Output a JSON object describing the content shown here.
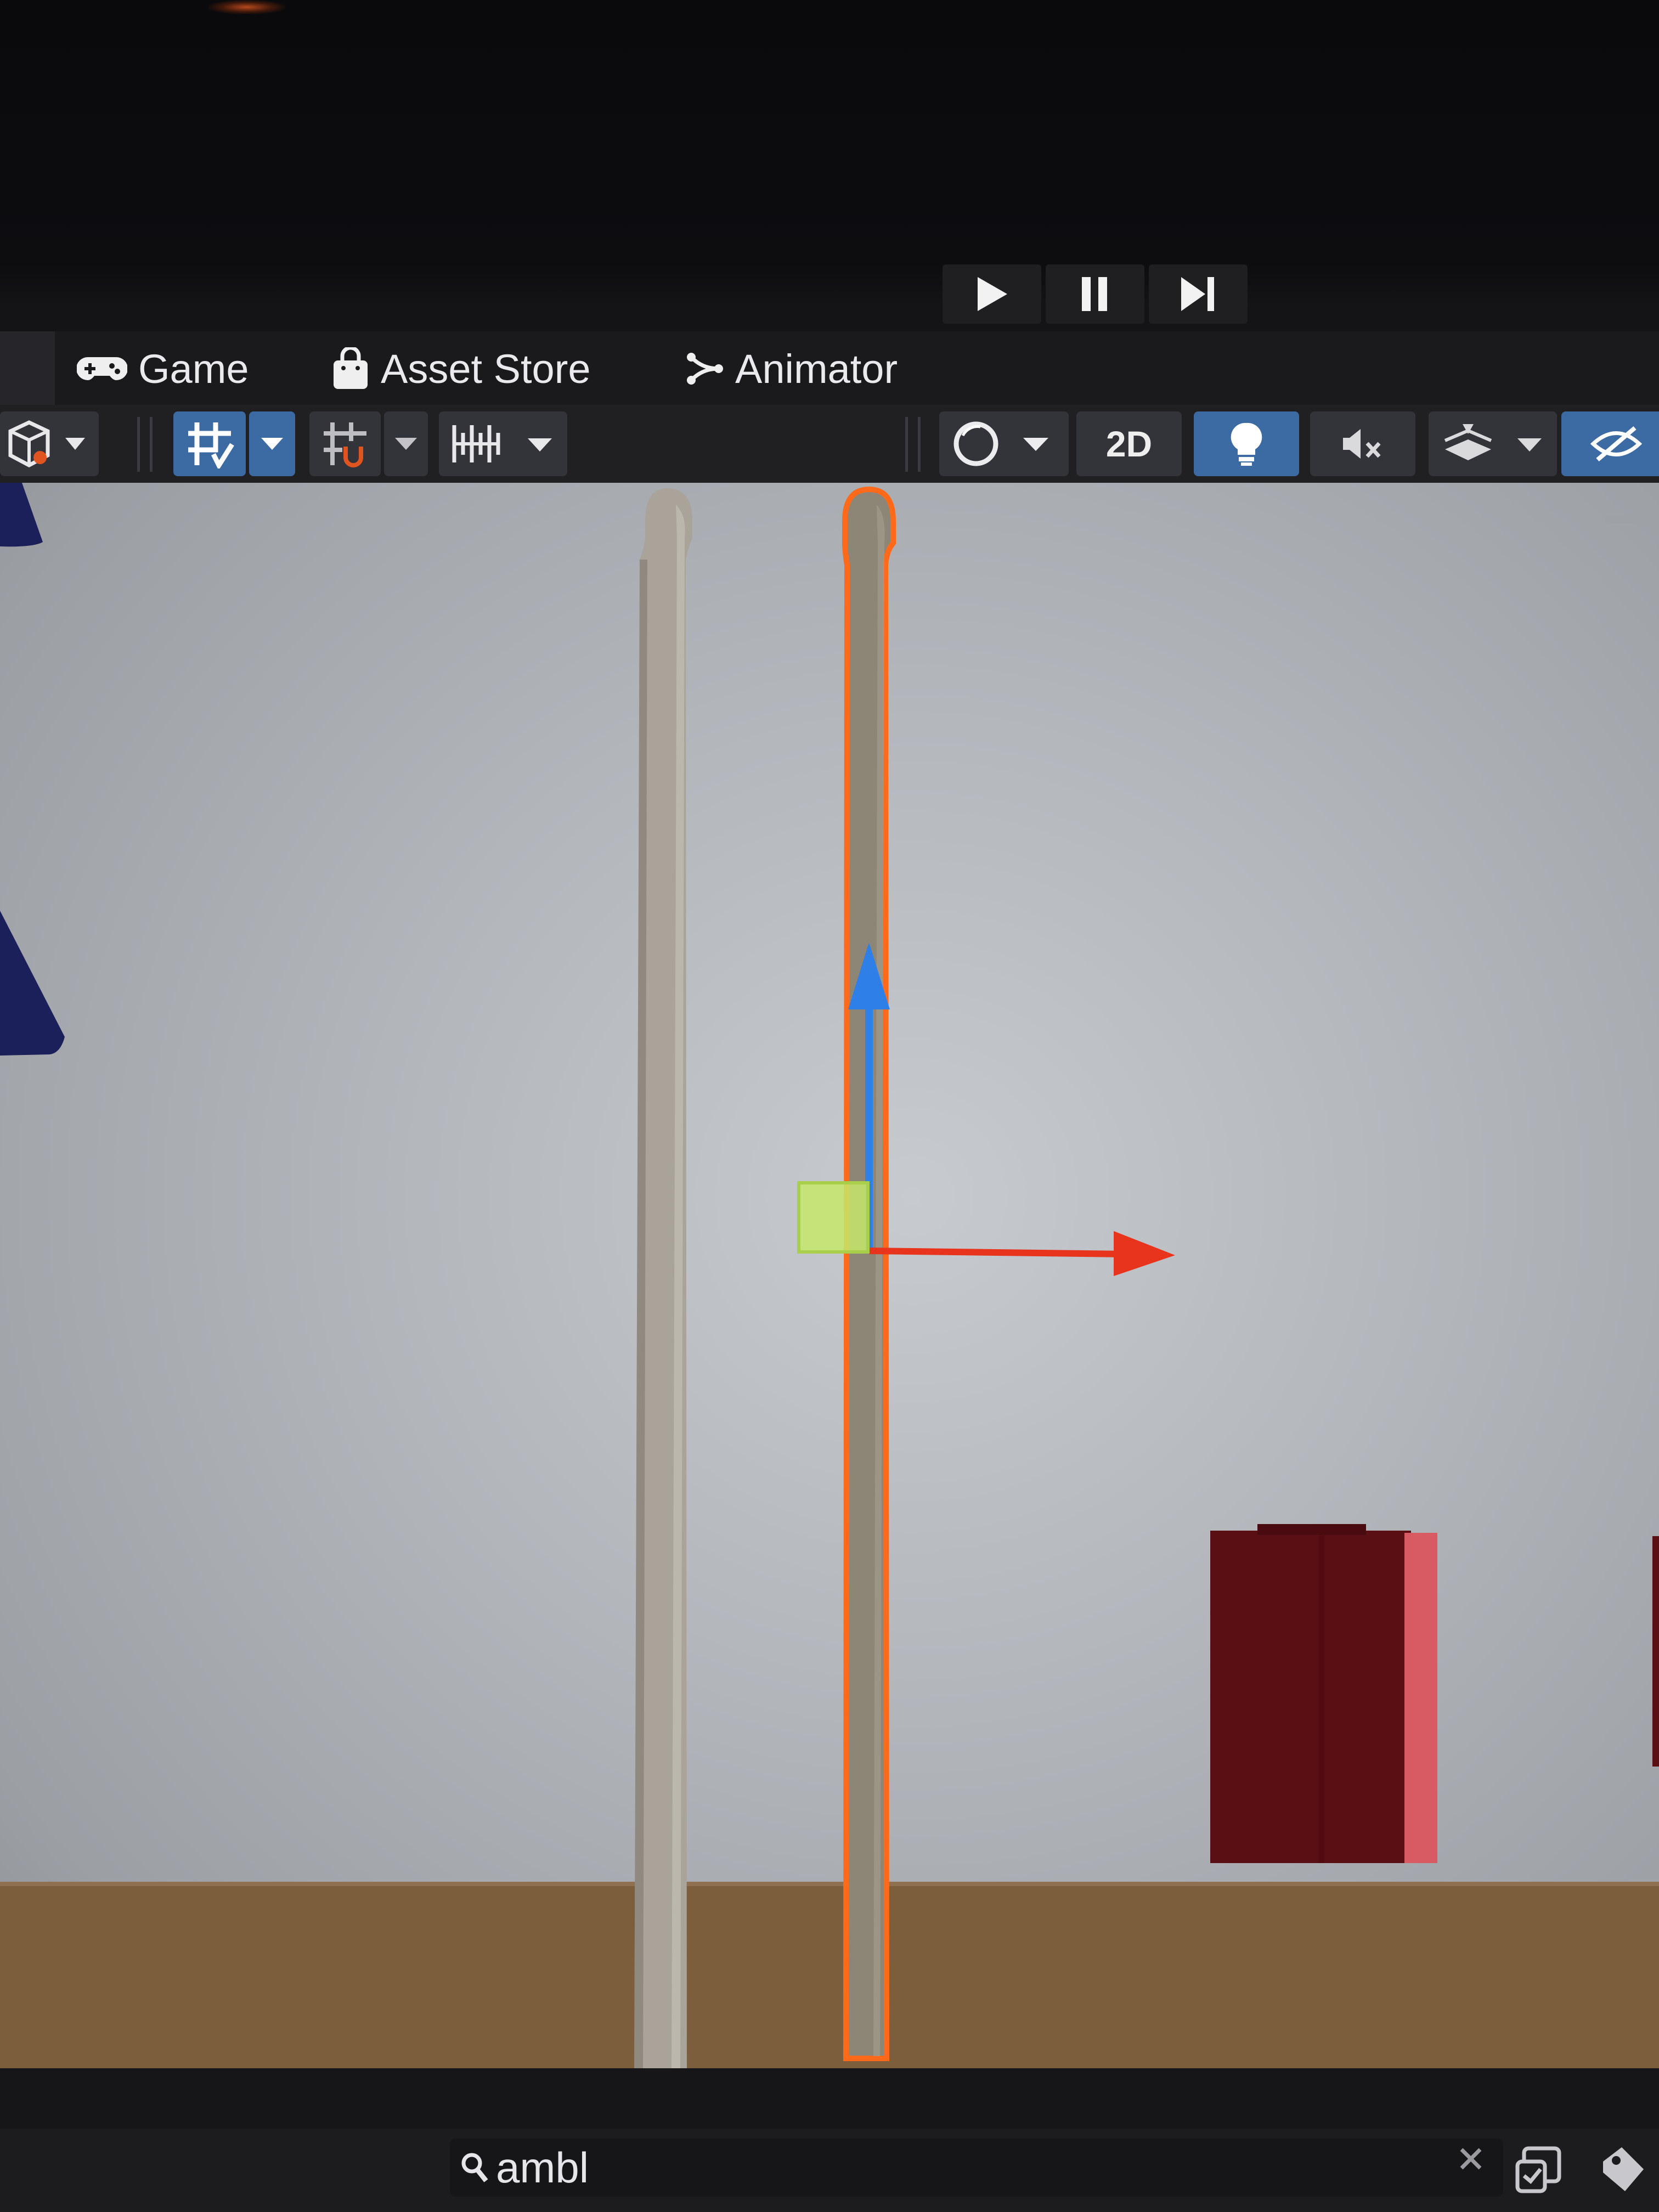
{
  "play_controls": {
    "play_icon": "play-icon",
    "pause_icon": "pause-icon",
    "step_icon": "step-icon"
  },
  "tabs": [
    {
      "label": "Game",
      "icon": "gamepad-icon"
    },
    {
      "label": "Asset Store",
      "icon": "shopping-bag-icon"
    },
    {
      "label": "Animator",
      "icon": "animator-icon"
    }
  ],
  "toolbar": {
    "mode_2d_label": "2D",
    "lighting_active": true,
    "scene_visibility_active": true
  },
  "search": {
    "value": "ambl"
  },
  "colors": {
    "active_button": "#3c6aa3",
    "selection_outline": "#ff6a1a",
    "gizmo_y_axis": "#2f7fe8",
    "gizmo_x_axis": "#e8341c",
    "gizmo_plane_handle": "#c6e86a"
  }
}
